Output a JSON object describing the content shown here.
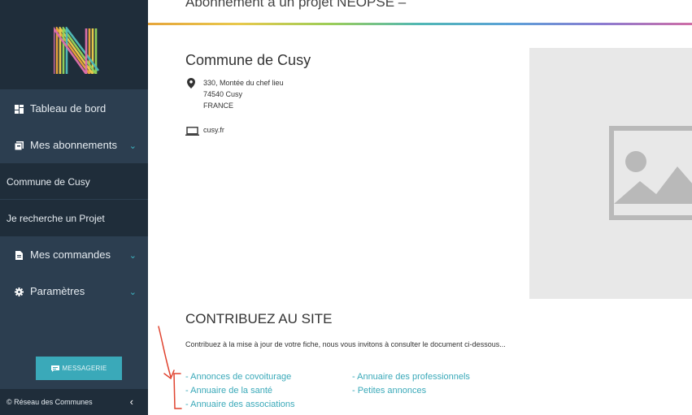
{
  "header": {
    "title": "Abonnement à un projet NEOPSE –"
  },
  "sidebar": {
    "items": [
      {
        "label": "Tableau de bord"
      },
      {
        "label": "Mes abonnements"
      },
      {
        "label": "Commune de Cusy"
      },
      {
        "label": "Je recherche un Projet"
      },
      {
        "label": "Mes commandes"
      },
      {
        "label": "Paramètres"
      }
    ],
    "messagerie_label": "MESSAGERIE",
    "footer": "© Réseau des Communes"
  },
  "organization": {
    "name": "Commune de Cusy",
    "address": [
      "330, Montée du chef lieu",
      "74540 Cusy",
      "FRANCE"
    ],
    "website": "cusy.fr"
  },
  "contribute": {
    "title": "CONTRIBUEZ AU SITE",
    "text": "Contribuez à la mise à jour de votre fiche, nous vous invitons à consulter le document ci-dessous...",
    "links": [
      "- Annonces de covoiturage",
      "- Annuaire de la santé",
      "- Annuaire des associations",
      "- Annuaire des professionnels",
      "- Petites annonces"
    ]
  },
  "colors": {
    "sidebar": "#2c3e50",
    "sidebar_dark": "#1f2d3a",
    "accent": "#3aa9b9",
    "annotation": "#e0432f"
  }
}
